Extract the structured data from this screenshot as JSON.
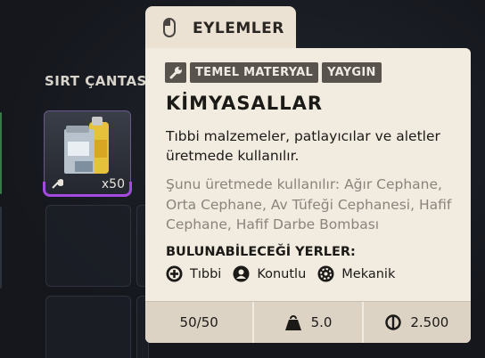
{
  "backpack": {
    "title": "SIRT ÇANTASI",
    "item": {
      "quantity": "x50",
      "icon": "chemicals-icon"
    }
  },
  "tooltip": {
    "tab_label": "EYLEMLER",
    "tags": [
      "TEMEL MATERYAL",
      "YAYGIN"
    ],
    "item_name": "KİMYASALLAR",
    "description": "Tıbbi malzemeler, patlayıcılar ve aletler üretmede kullanılır.",
    "used_in": "Şunu üretmede kullanılır: Ağır Cephane, Orta Cephane, Av Tüfeği Cephanesi, Hafif Cephane, Hafif Darbe Bombası",
    "locations_title": "BULUNABİLECEĞİ YERLER:",
    "locations": [
      {
        "label": "Tıbbi",
        "icon": "medical-icon"
      },
      {
        "label": "Konutlu",
        "icon": "residential-icon"
      },
      {
        "label": "Mekanik",
        "icon": "mechanical-icon"
      }
    ],
    "stats": {
      "stack": "50/50",
      "weight": "5.0",
      "price": "2.500"
    }
  },
  "colors": {
    "panel": "#f1ebe0",
    "footer": "#ddd3c4",
    "tag": "#58534d",
    "rarity_accent": "#a54ae0",
    "background": "#15171d"
  }
}
